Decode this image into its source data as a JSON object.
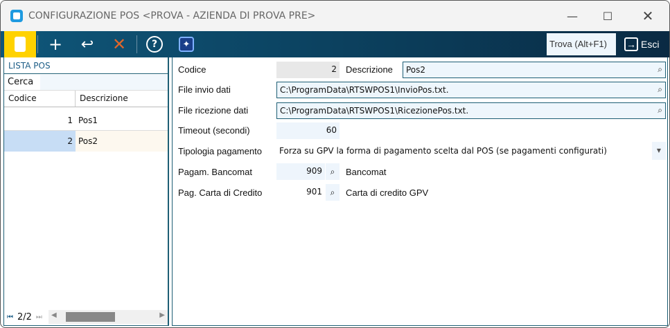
{
  "window": {
    "title": "CONFIGURAZIONE POS <PROVA - AZIENDA DI PROVA PRE>"
  },
  "toolbar": {
    "find_label": "Trova (Alt+F1)",
    "exit_label": "Esci"
  },
  "list": {
    "title": "LISTA POS",
    "search_label": "Cerca",
    "search_value": "",
    "columns": [
      "Codice",
      "Descrizione"
    ],
    "rows": [
      {
        "code": "1",
        "desc": "Pos1"
      },
      {
        "code": "2",
        "desc": "Pos2"
      }
    ],
    "pager": "2/2"
  },
  "form": {
    "codice_label": "Codice",
    "codice": "2",
    "descrizione_label": "Descrizione",
    "descrizione": "Pos2",
    "file_invio_label": "File invio dati",
    "file_invio": "C:\\ProgramData\\RTSWPOS1\\InvioPos.txt.",
    "file_ricezione_label": "File ricezione dati",
    "file_ricezione": "C:\\ProgramData\\RTSWPOS1\\RicezionePos.txt.",
    "timeout_label": "Timeout (secondi)",
    "timeout": "60",
    "tipologia_label": "Tipologia pagamento",
    "tipologia": "Forza su GPV la forma di pagamento scelta dal POS (se pagamenti configurati)",
    "bancomat_label": "Pagam. Bancomat",
    "bancomat_code": "909",
    "bancomat_desc": "Bancomat",
    "carta_label": "Pag. Carta di Credito",
    "carta_code": "901",
    "carta_desc": "Carta di credito GPV"
  }
}
